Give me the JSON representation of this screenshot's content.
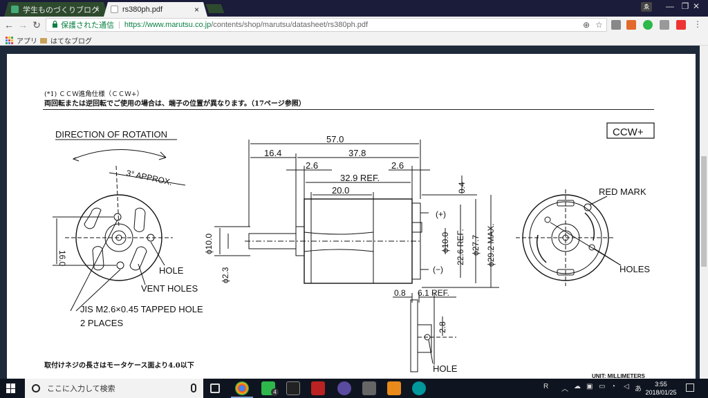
{
  "browser": {
    "tabs": [
      {
        "label": "学生ものづくりブログ",
        "close": "×"
      },
      {
        "label": "rs380ph.pdf",
        "close": "×"
      }
    ],
    "window_controls": {
      "profile": "ゑ",
      "minimize": "—",
      "restore": "❐",
      "close": "✕"
    },
    "nav": {
      "back": "←",
      "forward": "→",
      "reload": "↻"
    },
    "omnibox": {
      "lock": "🔒",
      "secure_label": "保護された通信",
      "url_host": "https://www.marutsu.co.jp",
      "url_path": "/contents/shop/marutsu/datasheet/rs380ph.pdf"
    },
    "bookmarks": [
      {
        "label": "アプリ"
      },
      {
        "label": "はてなブログ"
      }
    ]
  },
  "document": {
    "note_title": "(*1) ＣＣＷ進角仕様（ＣＣＷ+）",
    "note_body": "両回転または逆回転でご使用の場合は、端子の位置が異なります。（17ページ参照）",
    "footer_note": "取付けネジの長さはモータケース面より4.0以下",
    "unit_label": "UNIT: MILLIMETERS",
    "ccw_label": "CCW+",
    "left_view": {
      "direction": "DIRECTION OF ROTATION",
      "approx": "3° APPROX.",
      "dim_16": "16.0",
      "hole": "HOLE",
      "vent": "VENT HOLES",
      "tapped": "JIS M2.6×0.45 TAPPED HOLE",
      "places": "2 PLACES"
    },
    "side_view": {
      "d57": "57.0",
      "d164": "16.4",
      "d378": "37.8",
      "d26a": "2.6",
      "d26b": "2.6",
      "d329": "32.9 REF.",
      "d200": "20.0",
      "d04": "0.4",
      "plus": "(+)",
      "minus": "(−)",
      "phi10l": "ϕ10.0",
      "phi23": "ϕ2.3",
      "phi10r": "ϕ10.0",
      "d226": "22.6 REF.",
      "phi277": "ϕ27.7",
      "phi292": "ϕ29.2 MAX.",
      "d08": "0.8",
      "d61": "6.1 REF.",
      "d28": "2.8",
      "hole": "HOLE"
    },
    "right_view": {
      "red_mark": "RED MARK",
      "holes": "HOLES"
    }
  },
  "taskbar": {
    "search_placeholder": "ここに入力して検索",
    "tray_r": "R",
    "tray_lang": "あ",
    "time": "3:55",
    "date": "2018/01/25",
    "line_badge": "4"
  }
}
